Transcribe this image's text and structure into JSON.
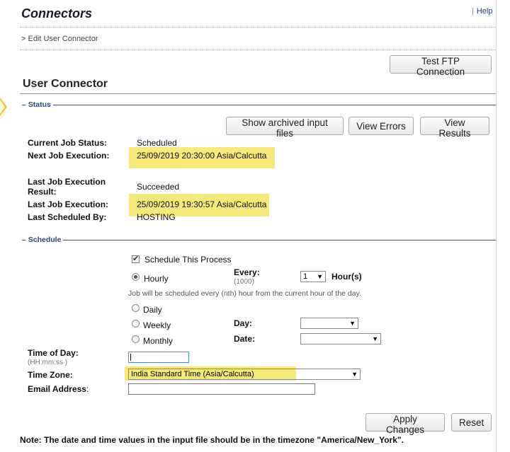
{
  "header": {
    "title": "Connectors",
    "help_label": "Help",
    "separator": "|"
  },
  "breadcrumb": {
    "text": "> Edit User Connector"
  },
  "toolbar": {
    "test_ftp_label": "Test FTP Connection"
  },
  "section_title": "User Connector",
  "status": {
    "legend": "– Status",
    "buttons": {
      "archived": "Show archived input files",
      "errors": "View Errors",
      "results": "View Results"
    },
    "rows": {
      "current_status_label": "Current Job Status:",
      "current_status_value": "Scheduled",
      "next_exec_label": "Next Job Execution:",
      "next_exec_value": "25/09/2019 20:30:00 Asia/Calcutta",
      "last_result_label_1": "Last Job Execution",
      "last_result_label_2": "Result:",
      "last_result_value": "Succeeded",
      "last_exec_label": "Last Job Execution:",
      "last_exec_value": "25/09/2019 19:30:57 Asia/Calcutta",
      "last_by_label": "Last Scheduled By:",
      "last_by_value": "HOSTING"
    }
  },
  "schedule": {
    "legend": "– Schedule",
    "schedule_process_label": "Schedule This Process",
    "hourly_label": "Hourly",
    "every_label": "Every:",
    "every_sub": "(1000)",
    "every_value": "1",
    "hours_label": "Hour(s)",
    "hint": "Job will be scheduled every (nth) hour from the current hour of the day.",
    "daily_label": "Daily",
    "weekly_label": "Weekly",
    "monthly_label": "Monthly",
    "day_label": "Day:",
    "date_label": "Date:",
    "day_value": "",
    "date_value": "",
    "time_of_day_label": "Time of Day:",
    "time_of_day_sub": "(HH:mm:ss )",
    "time_of_day_value": "",
    "timezone_label": "Time Zone:",
    "timezone_value": "India Standard Time (Asia/Calcutta)",
    "email_label": "Email Address",
    "email_colon": ":",
    "email_value": ""
  },
  "actions": {
    "apply_label": "Apply Changes",
    "reset_label": "Reset"
  },
  "note": "Note: The date and time values in the input file should be in the timezone \"America/New_York\".",
  "colors": {
    "highlight": "#f5e97a",
    "legend": "#2a4a80"
  }
}
